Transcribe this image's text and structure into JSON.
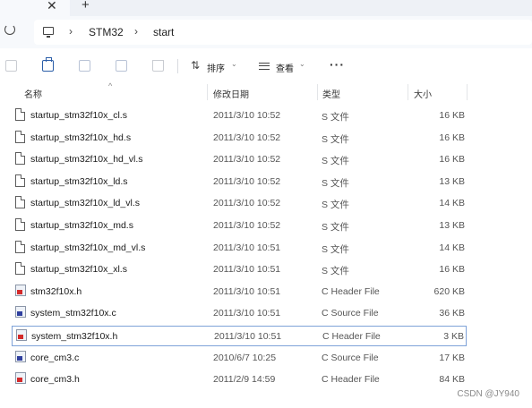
{
  "tabs": {
    "close_glyph": "✕",
    "new_glyph": "+"
  },
  "address": {
    "separator": "›",
    "breadcrumbs": [
      "STM32",
      "start"
    ]
  },
  "toolbar": {
    "sort_label": "排序",
    "view_label": "查看",
    "more_label": "···",
    "chevron": "⌄"
  },
  "columns": {
    "name": "名称",
    "date": "修改日期",
    "type": "类型",
    "size": "大小"
  },
  "files": [
    {
      "name": "startup_stm32f10x_cl.s",
      "date": "2011/3/10 10:52",
      "type": "S 文件",
      "size": "16 KB",
      "icon": "s-file-icon"
    },
    {
      "name": "startup_stm32f10x_hd.s",
      "date": "2011/3/10 10:52",
      "type": "S 文件",
      "size": "16 KB",
      "icon": "s-file-icon"
    },
    {
      "name": "startup_stm32f10x_hd_vl.s",
      "date": "2011/3/10 10:52",
      "type": "S 文件",
      "size": "16 KB",
      "icon": "s-file-icon"
    },
    {
      "name": "startup_stm32f10x_ld.s",
      "date": "2011/3/10 10:52",
      "type": "S 文件",
      "size": "13 KB",
      "icon": "s-file-icon"
    },
    {
      "name": "startup_stm32f10x_ld_vl.s",
      "date": "2011/3/10 10:52",
      "type": "S 文件",
      "size": "14 KB",
      "icon": "s-file-icon"
    },
    {
      "name": "startup_stm32f10x_md.s",
      "date": "2011/3/10 10:52",
      "type": "S 文件",
      "size": "13 KB",
      "icon": "s-file-icon"
    },
    {
      "name": "startup_stm32f10x_md_vl.s",
      "date": "2011/3/10 10:51",
      "type": "S 文件",
      "size": "14 KB",
      "icon": "s-file-icon"
    },
    {
      "name": "startup_stm32f10x_xl.s",
      "date": "2011/3/10 10:51",
      "type": "S 文件",
      "size": "16 KB",
      "icon": "s-file-icon"
    },
    {
      "name": "stm32f10x.h",
      "date": "2011/3/10 10:51",
      "type": "C Header File",
      "size": "620 KB",
      "icon": "c-header-icon"
    },
    {
      "name": "system_stm32f10x.c",
      "date": "2011/3/10 10:51",
      "type": "C Source File",
      "size": "36 KB",
      "icon": "c-source-icon"
    },
    {
      "name": "system_stm32f10x.h",
      "date": "2011/3/10 10:51",
      "type": "C Header File",
      "size": "3 KB",
      "icon": "c-header-icon",
      "selected": true
    },
    {
      "name": "core_cm3.c",
      "date": "2010/6/7 10:25",
      "type": "C Source File",
      "size": "17 KB",
      "icon": "c-source-icon"
    },
    {
      "name": "core_cm3.h",
      "date": "2011/2/9 14:59",
      "type": "C Header File",
      "size": "84 KB",
      "icon": "c-header-icon"
    }
  ],
  "watermark": "CSDN @JY940"
}
